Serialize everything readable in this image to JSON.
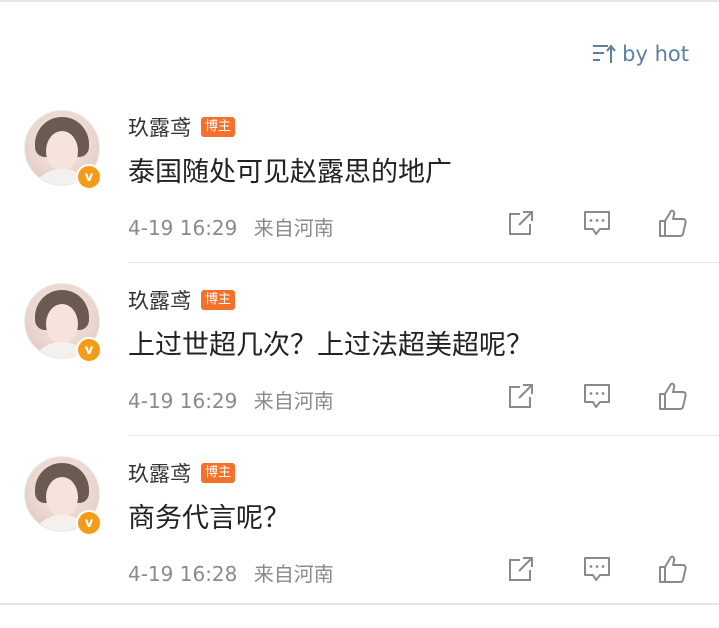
{
  "sort": {
    "label": "by hot"
  },
  "comments": [
    {
      "user": "玖露鸢",
      "badge": "博主",
      "verified": "v",
      "text": "泰国随处可见赵露思的地广",
      "time": "4-19 16:29",
      "source": "来自河南"
    },
    {
      "user": "玖露鸢",
      "badge": "博主",
      "verified": "v",
      "text": "上过世超几次？上过法超美超呢？",
      "time": "4-19 16:29",
      "source": "来自河南"
    },
    {
      "user": "玖露鸢",
      "badge": "博主",
      "verified": "v",
      "text": "商务代言呢？",
      "time": "4-19 16:28",
      "source": "来自河南"
    }
  ],
  "icons": {
    "sort": "sort-lines-icon",
    "share": "share-icon",
    "reply": "reply-icon",
    "like": "like-icon"
  },
  "colors": {
    "accent": "#5c7fa8",
    "badge": "#f5702a",
    "verified": "#f59b1a",
    "meta": "#8a8a8a"
  }
}
